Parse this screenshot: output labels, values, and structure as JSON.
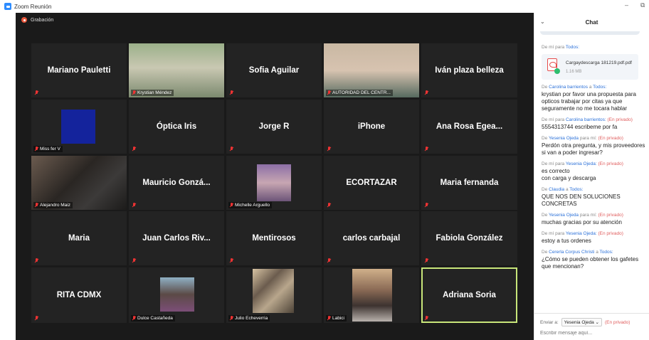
{
  "window": {
    "title": "Zoom Reunión",
    "minimize": "–",
    "restore": "⧉"
  },
  "recording": {
    "label": "Grabación"
  },
  "tiles": [
    {
      "id": "mariano",
      "name": "Mariano Pauletti",
      "label": ""
    },
    {
      "id": "krystian",
      "name": "",
      "label": "Krystian Méndez"
    },
    {
      "id": "sofia",
      "name": "Sofia Aguilar",
      "label": ""
    },
    {
      "id": "autoridad",
      "name": "",
      "label": "AUTORIDAD DEL CENTR..."
    },
    {
      "id": "ivan",
      "name": "Iván plaza belleza",
      "label": ""
    },
    {
      "id": "missfer",
      "name": "",
      "label": "Miss fer V"
    },
    {
      "id": "optica",
      "name": "Óptica Iris",
      "label": ""
    },
    {
      "id": "jorge",
      "name": "Jorge R",
      "label": ""
    },
    {
      "id": "iphone",
      "name": "iPhone",
      "label": ""
    },
    {
      "id": "anarosa",
      "name": "Ana Rosa Egea...",
      "label": ""
    },
    {
      "id": "alejandro",
      "name": "",
      "label": "Alejandro Maiz"
    },
    {
      "id": "mauricio",
      "name": "Mauricio Gonzá...",
      "label": ""
    },
    {
      "id": "michelle",
      "name": "",
      "label": "Michelle Arguello"
    },
    {
      "id": "ecortazar",
      "name": "ECORTAZAR",
      "label": ""
    },
    {
      "id": "mariaf",
      "name": "Maria fernanda",
      "label": ""
    },
    {
      "id": "maria",
      "name": "Maria",
      "label": ""
    },
    {
      "id": "juancarlos",
      "name": "Juan Carlos Riv...",
      "label": ""
    },
    {
      "id": "mentirosos",
      "name": "Mentirosos",
      "label": ""
    },
    {
      "id": "carlos",
      "name": "carlos carbajal",
      "label": ""
    },
    {
      "id": "fabiola",
      "name": "Fabiola González",
      "label": ""
    },
    {
      "id": "rita",
      "name": "RITA CDMX",
      "label": ""
    },
    {
      "id": "dulce",
      "name": "",
      "label": "Dulce Castañeda"
    },
    {
      "id": "julio",
      "name": "",
      "label": "Julio Echeverria"
    },
    {
      "id": "labici",
      "name": "",
      "label": "Labici"
    },
    {
      "id": "adriana",
      "name": "Adriana Soria",
      "label": ""
    }
  ],
  "chat": {
    "title": "Chat",
    "chevron": "⌄",
    "messages": [
      {
        "from": "De mí para",
        "to": "Todos:",
        "private": "",
        "text": "",
        "file": {
          "name": "Cargaydescarga 181219.pdf.pdf",
          "size": "1.16 MB"
        }
      },
      {
        "from": "De",
        "who": "Carolina barrientos",
        "mid": "a",
        "to": "Todos:",
        "private": "",
        "text": "krystian por favor una propuesta para opticos trabajar por citas ya que seguramente no me tocara hablar"
      },
      {
        "from": "De mí para",
        "who": "Carolina barrientos:",
        "to": "",
        "private": "(En privado)",
        "text": "5554313744 escribeme por fa"
      },
      {
        "from": "De",
        "who": "Yesenia Ojeda",
        "mid": "para mí:",
        "to": "",
        "private": "(En privado)",
        "text": "Perdón otra pregunta,  y mis proveedores si van a poder ingresar?"
      },
      {
        "from": "De mí para",
        "who": "Yesenia Ojeda:",
        "to": "",
        "private": "(En privado)",
        "text": "es correcto\ncon carga y descarga"
      },
      {
        "from": "De",
        "who": "Claudia",
        "mid": "a",
        "to": "Todos:",
        "private": "",
        "text": "QUE NOS DEN SOLUCIONES CONCRETAS"
      },
      {
        "from": "De",
        "who": "Yesenia Ojeda",
        "mid": "para mí:",
        "to": "",
        "private": "(En privado)",
        "text": "muchas gracias por su atención"
      },
      {
        "from": "De mí para",
        "who": "Yesenia Ojeda:",
        "to": "",
        "private": "(En privado)",
        "text": "estoy a tus ordenes"
      },
      {
        "from": "De",
        "who": "Cererla Corpus Christi",
        "mid": "a",
        "to": "Todos:",
        "private": "",
        "text": "¿Cómo se pueden obtener los gafetes que mencionan?"
      }
    ],
    "footer": {
      "send_to": "Enviar a:",
      "recipient": "Yesenia Ojeda ⌄",
      "private": "(En privado)",
      "placeholder": "Escribir mensaje aquí..."
    }
  }
}
